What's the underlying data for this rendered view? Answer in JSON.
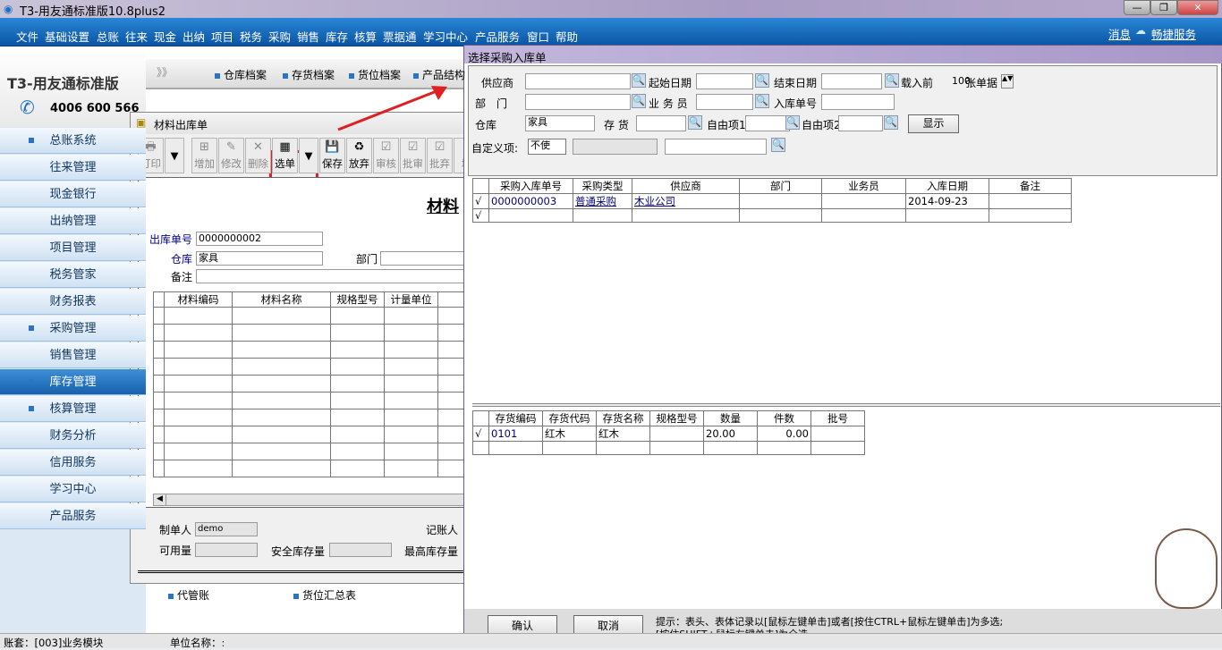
{
  "app": {
    "title": "T3-用友通标准版10.8plus2",
    "logo_text": "T3-用友通标准版",
    "phone": "4006 600 566"
  },
  "menu": [
    "文件",
    "基础设置",
    "总账",
    "往来",
    "现金",
    "出纳",
    "项目",
    "税务",
    "采购",
    "销售",
    "库存",
    "核算",
    "票据通",
    "学习中心",
    "产品服务",
    "窗口",
    "帮助"
  ],
  "top_right": {
    "messages": "消息",
    "service": "畅捷服务"
  },
  "sidebar": [
    {
      "label": "总账系统",
      "bullet": true
    },
    {
      "label": "往来管理"
    },
    {
      "label": "现金银行"
    },
    {
      "label": "出纳管理"
    },
    {
      "label": "项目管理"
    },
    {
      "label": "税务管家"
    },
    {
      "label": "财务报表"
    },
    {
      "label": "采购管理",
      "bullet": true
    },
    {
      "label": "销售管理"
    },
    {
      "label": "库存管理",
      "bullet": true,
      "selected": true
    },
    {
      "label": "核算管理",
      "bullet": true
    },
    {
      "label": "财务分析"
    },
    {
      "label": "信用服务"
    },
    {
      "label": "学习中心"
    },
    {
      "label": "产品服务"
    }
  ],
  "shortcuts": {
    "arrows": "》》",
    "items": [
      "仓库档案",
      "存货档案",
      "货位档案",
      "产品结构"
    ],
    "bottom": [
      "代管账",
      "货位汇总表"
    ]
  },
  "material_window": {
    "title": "材料出库单",
    "heading": "材料",
    "toolbar": [
      "打印",
      "▼",
      "增加",
      "修改",
      "删除",
      "选单",
      "▼",
      "保存",
      "放弃",
      "审核",
      "批审",
      "批弃",
      "增"
    ],
    "fields": {
      "no_label": "出库单号",
      "no": "0000000002",
      "wh_label": "仓库",
      "wh": "家具",
      "dept_label": "部门",
      "note_label": "备注"
    },
    "columns": [
      "材料编码",
      "材料名称",
      "规格型号",
      "计量单位"
    ],
    "footer": {
      "maker_label": "制单人",
      "maker": "demo",
      "bookkeeper_label": "记账人",
      "avail_label": "可用量",
      "safety_label": "安全库存量",
      "max_label": "最高库存量"
    }
  },
  "dialog": {
    "title": "选择采购入库单",
    "filters": {
      "supplier": "供应商",
      "start": "起始日期",
      "end": "结束日期",
      "load_pre": "载入前",
      "load_n": "100",
      "load_post": "张单据",
      "dept": "部　门",
      "clerk": "业 务 员",
      "in_no": "入库单号",
      "wh": "仓库",
      "wh_value": "家具",
      "stock": "存 货",
      "free1": "自由项1",
      "free2": "自由项2",
      "show": "显示",
      "custom": "自定义项:",
      "custom_sel": "不使"
    },
    "top_columns": [
      "采购入库单号",
      "采购类型",
      "供应商",
      "部门",
      "业务员",
      "入库日期",
      "备注"
    ],
    "top_rows": [
      [
        "√",
        "0000000003",
        "普通采购",
        "木业公司",
        "",
        "",
        "2014-09-23",
        ""
      ],
      [
        "√",
        "",
        "",
        "",
        "",
        "",
        "",
        ""
      ]
    ],
    "bottom_columns": [
      "存货编码",
      "存货代码",
      "存货名称",
      "规格型号",
      "数量",
      "件数",
      "批号"
    ],
    "bottom_rows": [
      [
        "√",
        "0101",
        "红木",
        "红木",
        "",
        "20.00",
        "0.00",
        ""
      ],
      [
        "",
        "",
        "",
        "",
        "",
        "",
        "",
        ""
      ]
    ],
    "confirm": "确认",
    "cancel": "取消",
    "hint1": "提示：表头、表体记录以[鼠标左键单击]或者[按住CTRL+鼠标左键单击]为多选;",
    "hint2": "[按住SHIFT+鼠标左键单击]为全选。"
  },
  "status": {
    "account": "账套：[003]业务模块",
    "unit": "单位名称：:"
  },
  "colors": {
    "menu": "#0b55a3",
    "highlight": "#e02020"
  }
}
